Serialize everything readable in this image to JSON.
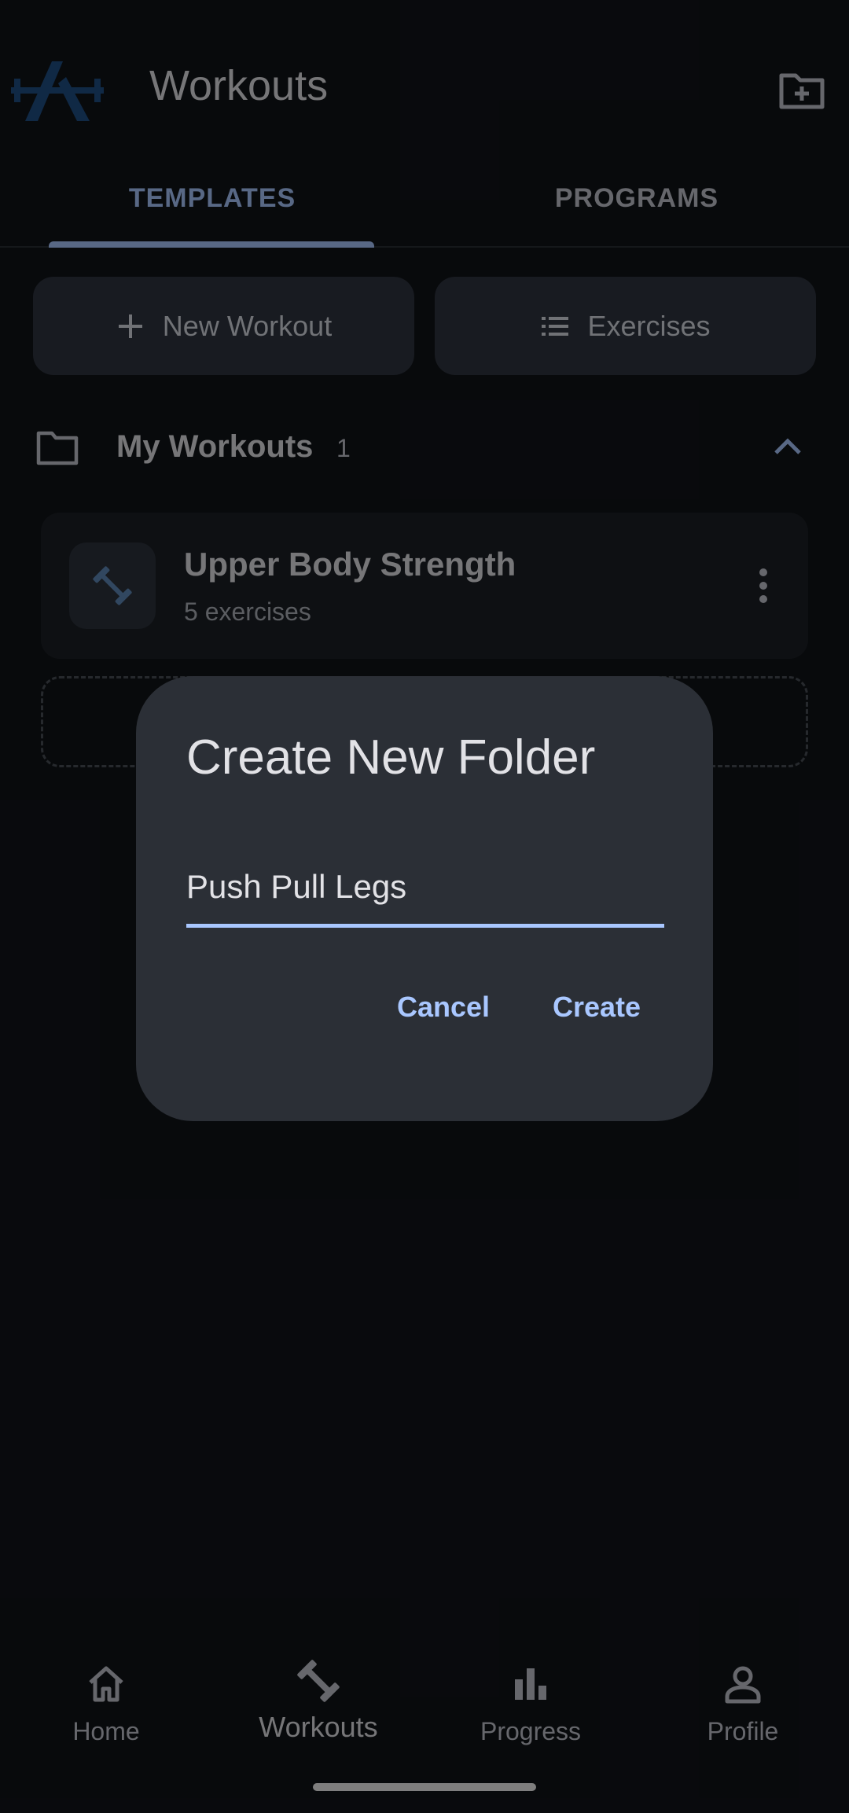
{
  "app": {
    "title": "Workouts",
    "accent": "#a9c7ff",
    "logo_icon": "barbell-logo-icon",
    "header_action_icon": "create-folder-icon"
  },
  "tabs": [
    {
      "label": "TEMPLATES",
      "selected": true
    },
    {
      "label": "PROGRAMS",
      "selected": false
    }
  ],
  "actions": {
    "new_workout": {
      "label": "New Workout",
      "icon": "plus-icon"
    },
    "exercises": {
      "label": "Exercises",
      "icon": "list-icon"
    }
  },
  "section": {
    "title": "My Workouts",
    "count": "1",
    "icon": "folder-icon",
    "expanded": true
  },
  "workouts": [
    {
      "name": "Upper Body Strength",
      "subtitle": "5 exercises",
      "icon": "dumbbell-icon"
    }
  ],
  "nav": [
    {
      "label": "Home",
      "icon": "home-icon",
      "active": false
    },
    {
      "label": "Workouts",
      "icon": "dumbbell-icon",
      "active": true
    },
    {
      "label": "Progress",
      "icon": "bar-chart-icon",
      "active": false
    },
    {
      "label": "Profile",
      "icon": "person-icon",
      "active": false
    }
  ],
  "dialog": {
    "title": "Create New Folder",
    "input_value": "Push Pull Legs",
    "cancel_label": "Cancel",
    "create_label": "Create"
  }
}
